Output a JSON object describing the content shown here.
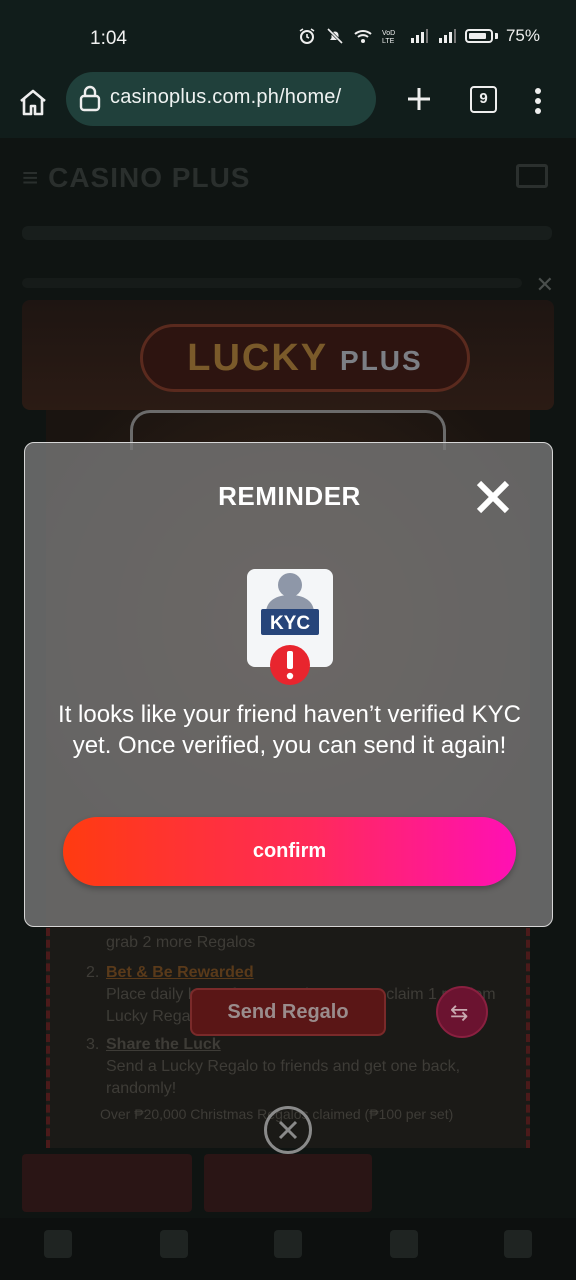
{
  "status_bar": {
    "time": "1:04",
    "battery": "75%"
  },
  "browser": {
    "url": "casinoplus.com.ph/home/",
    "tab_count": "9"
  },
  "background_page": {
    "send_regalo_label": "Send Regalo",
    "steps": {
      "line1": "grab 2 more Regalos",
      "step2_num": "2.",
      "step2_title": "Bet & Be Rewarded",
      "step2_desc_a": "Place daily bets of ₱120 and ₱5,000 to claim 1 random",
      "step2_desc_b": "Lucky Regalo",
      "step3_num": "3.",
      "step3_title": "Share the Luck",
      "step3_desc_a": "Send a Lucky Regalo to friends and get one back,",
      "step3_desc_b": "randomly!",
      "footer": "Over ₱20,000 Christmas Regalos claimed (₱100 per set)"
    }
  },
  "modal": {
    "title": "REMINDER",
    "kyc_badge": "KYC",
    "message": "It looks like your friend haven’t verified KYC yet. Once verified, you can send it again!",
    "confirm_label": "confirm"
  },
  "colors": {
    "confirm_gradient_start": "#ff3b10",
    "confirm_gradient_end": "#ff10b4",
    "kyc_badge": "#27457a",
    "alert_red": "#e8252e"
  }
}
